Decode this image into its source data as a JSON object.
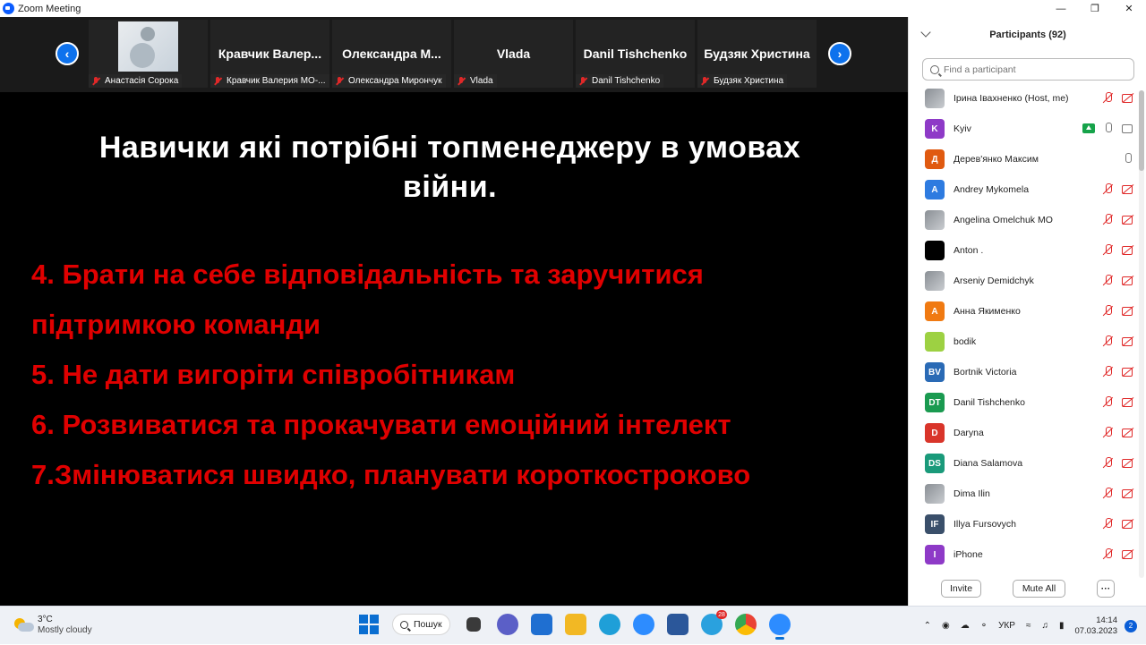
{
  "window": {
    "title": "Zoom Meeting"
  },
  "gallery": [
    {
      "label": "Анастасія Сорока",
      "name": "",
      "photo": true
    },
    {
      "label": "Кравчик Валерия МО-...",
      "name": "Кравчик  Валер..."
    },
    {
      "label": "Олександра Мирончук",
      "name": "Олександра  М..."
    },
    {
      "label": "Vlada",
      "name": "Vlada"
    },
    {
      "label": "Danil Tishchenko",
      "name": "Danil Tishchenko"
    },
    {
      "label": "Будзяк Христина",
      "name": "Будзяк Христина"
    }
  ],
  "slide": {
    "title_line1": "Навички які потрібні топменеджеру в умовах",
    "title_line2": "війни.",
    "points": [
      "4. Брати на себе відповідальність та заручитися",
      "підтримкою команди",
      "5. Не дати вигоріти співробітникам",
      "6. Розвиватися та прокачувати емоційний інтелект",
      "7.Змінюватися швидко, планувати короткостроково"
    ]
  },
  "panel": {
    "title": "Participants (92)",
    "search_placeholder": "Find a participant",
    "participants": [
      {
        "name": "Ірина Івахненко (Host, me)",
        "initials": "",
        "color": "",
        "photo": true,
        "icons": [
          "mic-muted",
          "cam-off"
        ]
      },
      {
        "name": "Kyiv",
        "initials": "K",
        "color": "#8e3ac7",
        "icons": [
          "share",
          "mic-on",
          "cam-on"
        ]
      },
      {
        "name": "Дерев'янко Максим",
        "initials": "Д",
        "color": "#e05a10",
        "icons": [
          "mic-on"
        ]
      },
      {
        "name": "Andrey Mykomela",
        "initials": "A",
        "color": "#2e7be0",
        "icons": [
          "mic-muted",
          "cam-off"
        ]
      },
      {
        "name": "Angelina Omelchuk MO",
        "initials": "",
        "color": "",
        "photo": true,
        "icons": [
          "mic-muted",
          "cam-off"
        ]
      },
      {
        "name": "Anton .",
        "initials": "",
        "color": "#000000",
        "icons": [
          "mic-muted",
          "cam-off"
        ]
      },
      {
        "name": "Arseniy Demidchyk",
        "initials": "",
        "color": "",
        "photo": true,
        "icons": [
          "mic-muted",
          "cam-off"
        ]
      },
      {
        "name": "Анна Якименко",
        "initials": "A",
        "color": "#f07a12",
        "icons": [
          "mic-muted",
          "cam-off"
        ]
      },
      {
        "name": "bodik",
        "initials": "",
        "color": "#9dd142",
        "photo": true,
        "icons": [
          "mic-muted",
          "cam-off"
        ]
      },
      {
        "name": "Bortnik Victoria",
        "initials": "BV",
        "color": "#2a6ab5",
        "icons": [
          "mic-muted",
          "cam-off"
        ]
      },
      {
        "name": "Danil Tishchenko",
        "initials": "DT",
        "color": "#1a9a50",
        "icons": [
          "mic-muted",
          "cam-off"
        ]
      },
      {
        "name": "Daryna",
        "initials": "D",
        "color": "#d9352a",
        "icons": [
          "mic-muted",
          "cam-off"
        ]
      },
      {
        "name": "Diana Salamova",
        "initials": "DS",
        "color": "#1a9a7a",
        "icons": [
          "mic-muted",
          "cam-off"
        ]
      },
      {
        "name": "Dima Ilin",
        "initials": "",
        "color": "",
        "photo": true,
        "icons": [
          "mic-muted",
          "cam-off"
        ]
      },
      {
        "name": "Illya Fursovych",
        "initials": "IF",
        "color": "#3a4f6a",
        "icons": [
          "mic-muted",
          "cam-off"
        ]
      },
      {
        "name": "iPhone",
        "initials": "I",
        "color": "#8e3ac7",
        "icons": [
          "mic-muted",
          "cam-off"
        ]
      }
    ],
    "invite_label": "Invite",
    "mute_all_label": "Mute All",
    "more_label": "···"
  },
  "taskbar": {
    "weather_temp": "3°C",
    "weather_condition": "Mostly cloudy",
    "search_label": "Пошук",
    "language": "УКР",
    "time": "14:14",
    "date": "07.03.2023",
    "notification_count": "2",
    "telegram_badge": "28"
  }
}
